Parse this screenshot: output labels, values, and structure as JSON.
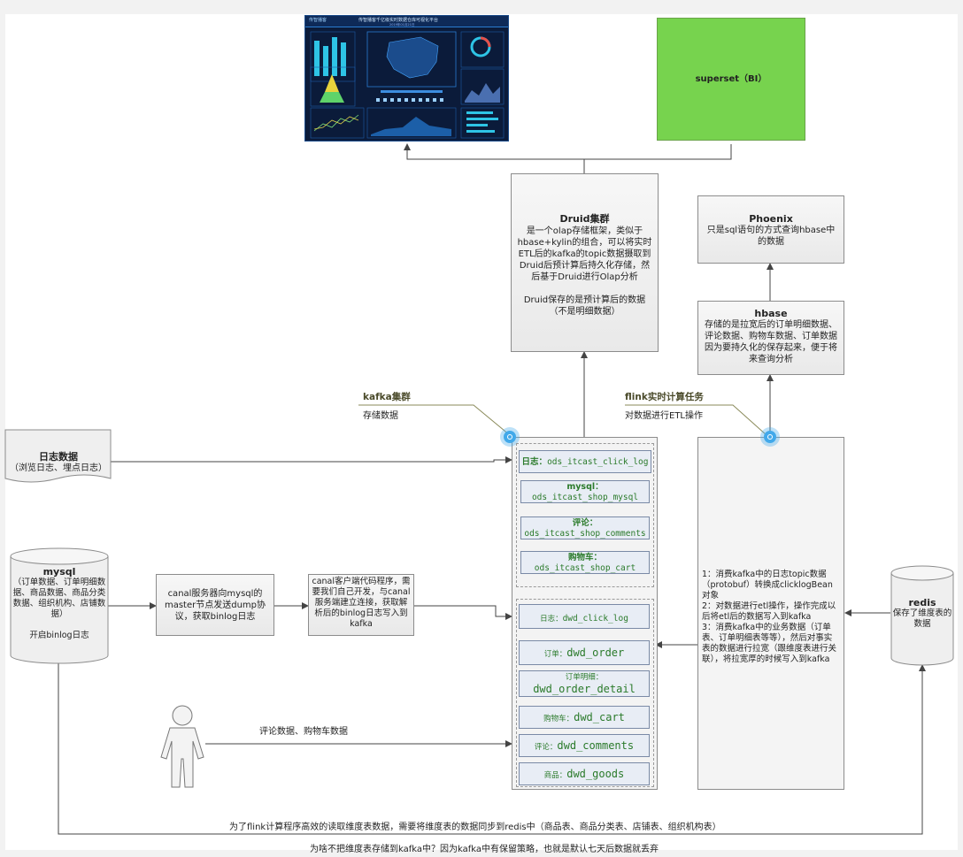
{
  "dashboard": {
    "header_left": "传智播客",
    "header_title": "传智播客千亿级实时数据仓库可视化平台",
    "header_sub": "2019年01月21日"
  },
  "superset": {
    "label": "superset（BI）",
    "color": "#77d34e"
  },
  "druid": {
    "title": "Druid集群",
    "desc": "是一个olap存储框架，类似于hbase+kylin的组合，可以将实时ETL后的kafka的topic数据摄取到Druid后预计算后持久化存储，然后基于Druid进行Olap分析",
    "desc2": "Druid保存的是预计算后的数据（不是明细数据）"
  },
  "phoenix": {
    "title": "Phoenix",
    "desc": "只是sql语句的方式查询hbase中的数据"
  },
  "hbase": {
    "title": "hbase",
    "desc": "存储的是拉宽后的订单明细数据、评论数据、购物车数据、订单数据因为要持久化的保存起来，便于将来查询分析"
  },
  "kafka": {
    "title": "kafka集群",
    "desc": "存储数据"
  },
  "flink": {
    "title": "flink实时计算任务",
    "desc": "对数据进行ETL操作",
    "steps": [
      "1：消费kafka中的日志topic数据（protobuf）转换成clicklogBean对象",
      "2：对数据进行etl操作，操作完成以后将etl后的数据写入到kafka",
      "3：消费kafka中的业务数据（订单表、订单明细表等等），然后对事实表的数据进行拉宽（跟维度表进行关联），将拉宽厚的时候写入到kafka"
    ]
  },
  "log_data": {
    "title": "日志数据",
    "desc": "（浏览日志、埋点日志）"
  },
  "mysql": {
    "title": "mysql",
    "desc": "（订单数据、订单明细数据、商品数据、商品分类数据、组织机构、店铺数据）",
    "note": "开启binlog日志"
  },
  "canal_server": {
    "desc": "canal服务器向mysql的master节点发送dump协议，获取binlog日志"
  },
  "canal_client": {
    "desc": "canal客户端代码程序，需要我们自己开发，与canal服务端建立连接，获取解析后的binlog日志写入到kafka"
  },
  "redis": {
    "title": "redis",
    "desc": "保存了维度表的数据"
  },
  "ods_topics": [
    {
      "prefix": "日志：",
      "name": "ods_itcast_click_log"
    },
    {
      "prefix": "mysql：",
      "name": "ods_itcast_shop_mysql"
    },
    {
      "prefix": "评论：",
      "name": "ods_itcast_shop_comments"
    },
    {
      "prefix": "购物车：",
      "name": "ods_itcast_shop_cart"
    }
  ],
  "dwd_topics": [
    {
      "prefix": "日志：",
      "name": "dwd_click_log"
    },
    {
      "prefix": "订单：",
      "name": "dwd_order"
    },
    {
      "prefix": "订单明细：",
      "name": "dwd_order_detail"
    },
    {
      "prefix": "购物车：",
      "name": "dwd_cart"
    },
    {
      "prefix": "评论：",
      "name": "dwd_comments"
    },
    {
      "prefix": "商品：",
      "name": "dwd_goods"
    }
  ],
  "user_note": "评论数据、购物车数据",
  "footer": {
    "line1": "为了flink计算程序高效的读取维度表数据，需要将维度表的数据同步到redis中（商品表、商品分类表、店铺表、组织机构表）",
    "line2": "为啥不把维度表存储到kafka中？因为kafka中有保留策略，也就是默认七天后数据就丢弃"
  }
}
